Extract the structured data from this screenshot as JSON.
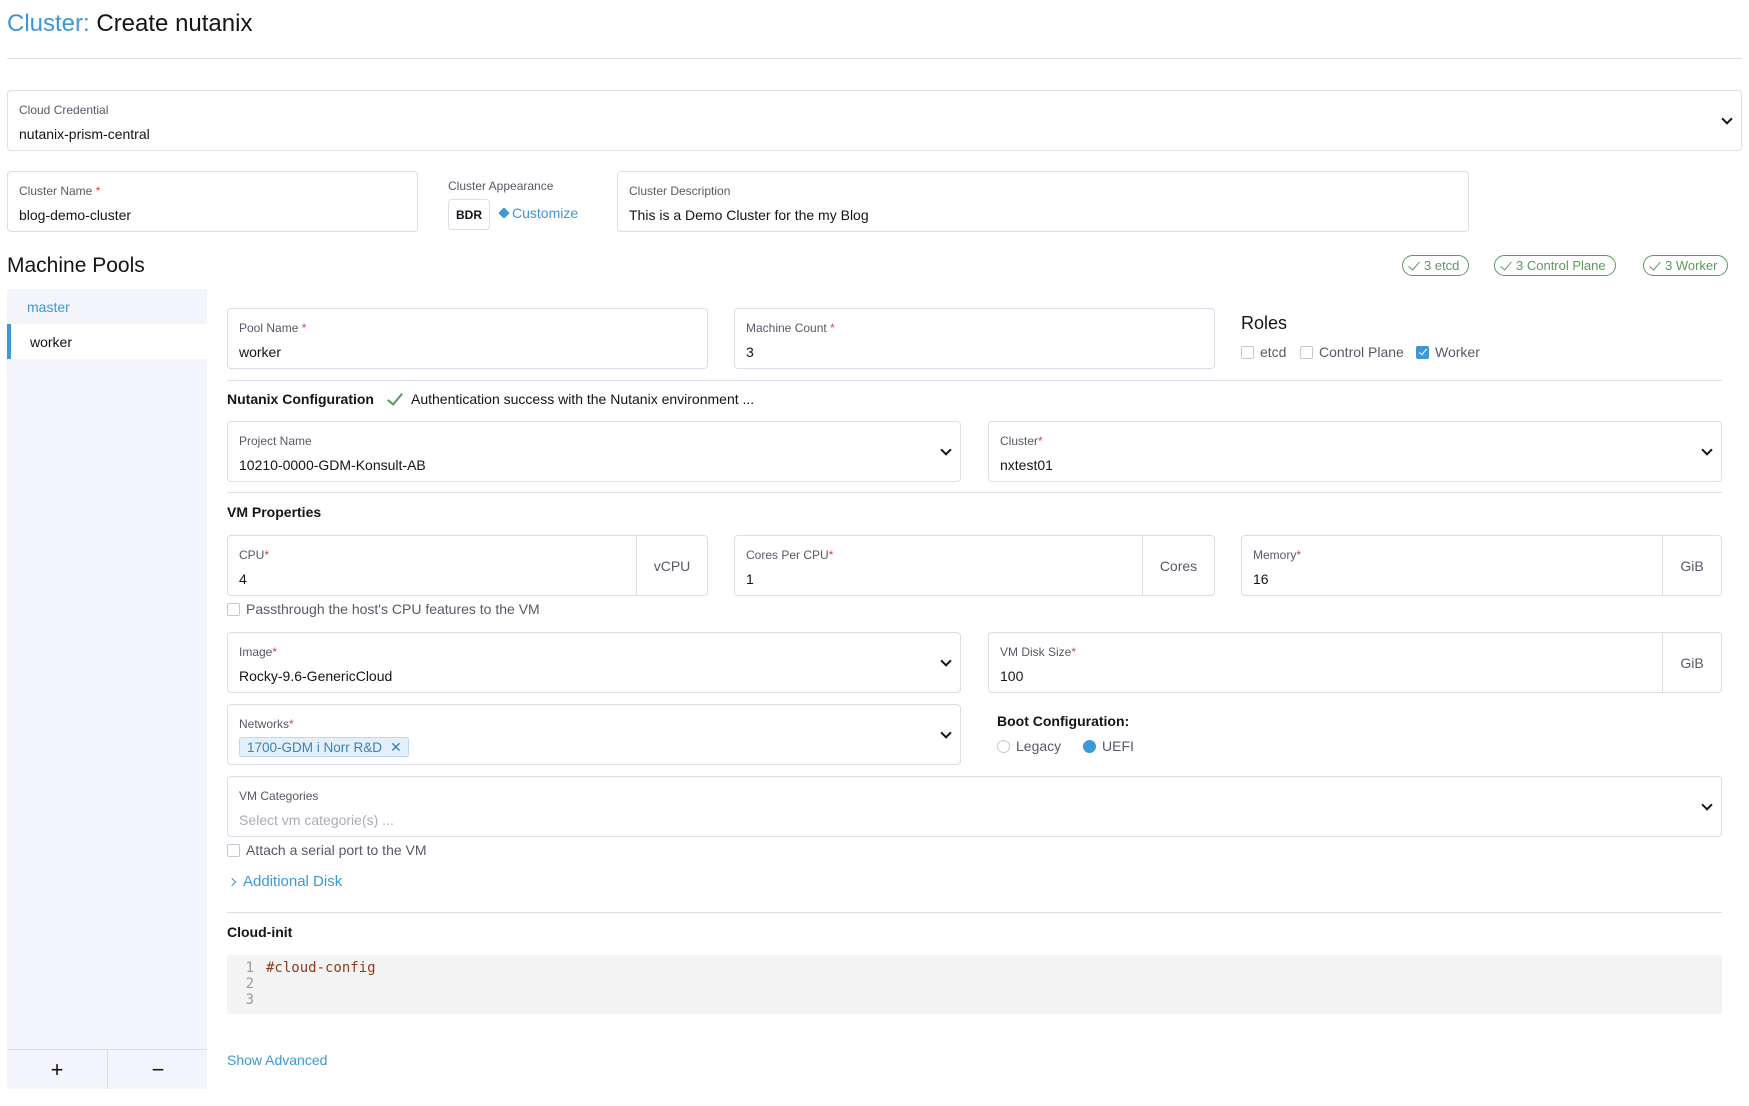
{
  "header": {
    "breadcrumb": "Cluster:",
    "title": "Create nutanix"
  },
  "cloud_credential": {
    "label": "Cloud Credential",
    "value": "nutanix-prism-central"
  },
  "cluster_name": {
    "label": "Cluster Name",
    "required_mark": "*",
    "value": "blog-demo-cluster"
  },
  "cluster_appearance": {
    "label": "Cluster Appearance",
    "badge": "BDR",
    "customize_label": "Customize"
  },
  "cluster_description": {
    "label": "Cluster Description",
    "value": "This is a Demo Cluster for the my Blog"
  },
  "machine_pools": {
    "title": "Machine Pools",
    "role_summary": [
      "3 etcd",
      "3 Control Plane",
      "3 Worker"
    ],
    "pools": [
      "master",
      "worker"
    ],
    "selected_pool": "worker",
    "add_label": "+",
    "remove_label": "−"
  },
  "pool": {
    "pool_name": {
      "label": "Pool Name",
      "value": "worker"
    },
    "machine_count": {
      "label": "Machine Count",
      "value": "3"
    },
    "roles": {
      "title": "Roles",
      "etcd": {
        "label": "etcd",
        "checked": false
      },
      "control_plane": {
        "label": "Control Plane",
        "checked": false
      },
      "worker": {
        "label": "Worker",
        "checked": true
      }
    }
  },
  "nutanix": {
    "title": "Nutanix Configuration",
    "auth_message": "Authentication success with the Nutanix environment ...",
    "project_name": {
      "label": "Project Name",
      "value": "10210-0000-GDM-Konsult-AB"
    },
    "cluster": {
      "label": "Cluster",
      "value": "nxtest01"
    }
  },
  "vm": {
    "title": "VM Properties",
    "cpu": {
      "label": "CPU",
      "value": "4",
      "unit": "vCPU"
    },
    "cores_per_cpu": {
      "label": "Cores Per CPU",
      "value": "1",
      "unit": "Cores"
    },
    "memory": {
      "label": "Memory",
      "value": "16",
      "unit": "GiB"
    },
    "passthrough_label": "Passthrough the host's CPU features to the VM",
    "image": {
      "label": "Image",
      "value": "Rocky-9.6-GenericCloud"
    },
    "disk_size": {
      "label": "VM Disk Size",
      "value": "100",
      "unit": "GiB"
    },
    "networks": {
      "label": "Networks",
      "chip": "1700-GDM i Norr R&D"
    },
    "boot": {
      "title": "Boot Configuration:",
      "legacy_label": "Legacy",
      "uefi_label": "UEFI",
      "selected": "UEFI"
    },
    "categories": {
      "label": "VM Categories",
      "placeholder": "Select vm categorie(s) ..."
    },
    "serial_port_label": "Attach a serial port to the VM",
    "additional_disk_label": "Additional Disk"
  },
  "cloud_init": {
    "title": "Cloud-init",
    "lines": [
      {
        "num": "1",
        "text": "#cloud-config"
      },
      {
        "num": "2",
        "text": ""
      },
      {
        "num": "3",
        "text": ""
      }
    ]
  },
  "footer": {
    "show_advanced": "Show Advanced"
  },
  "colors": {
    "accent": "#3d98d3",
    "success": "#5d995d",
    "required": "#e03e3e",
    "border": "#dcdee7"
  }
}
